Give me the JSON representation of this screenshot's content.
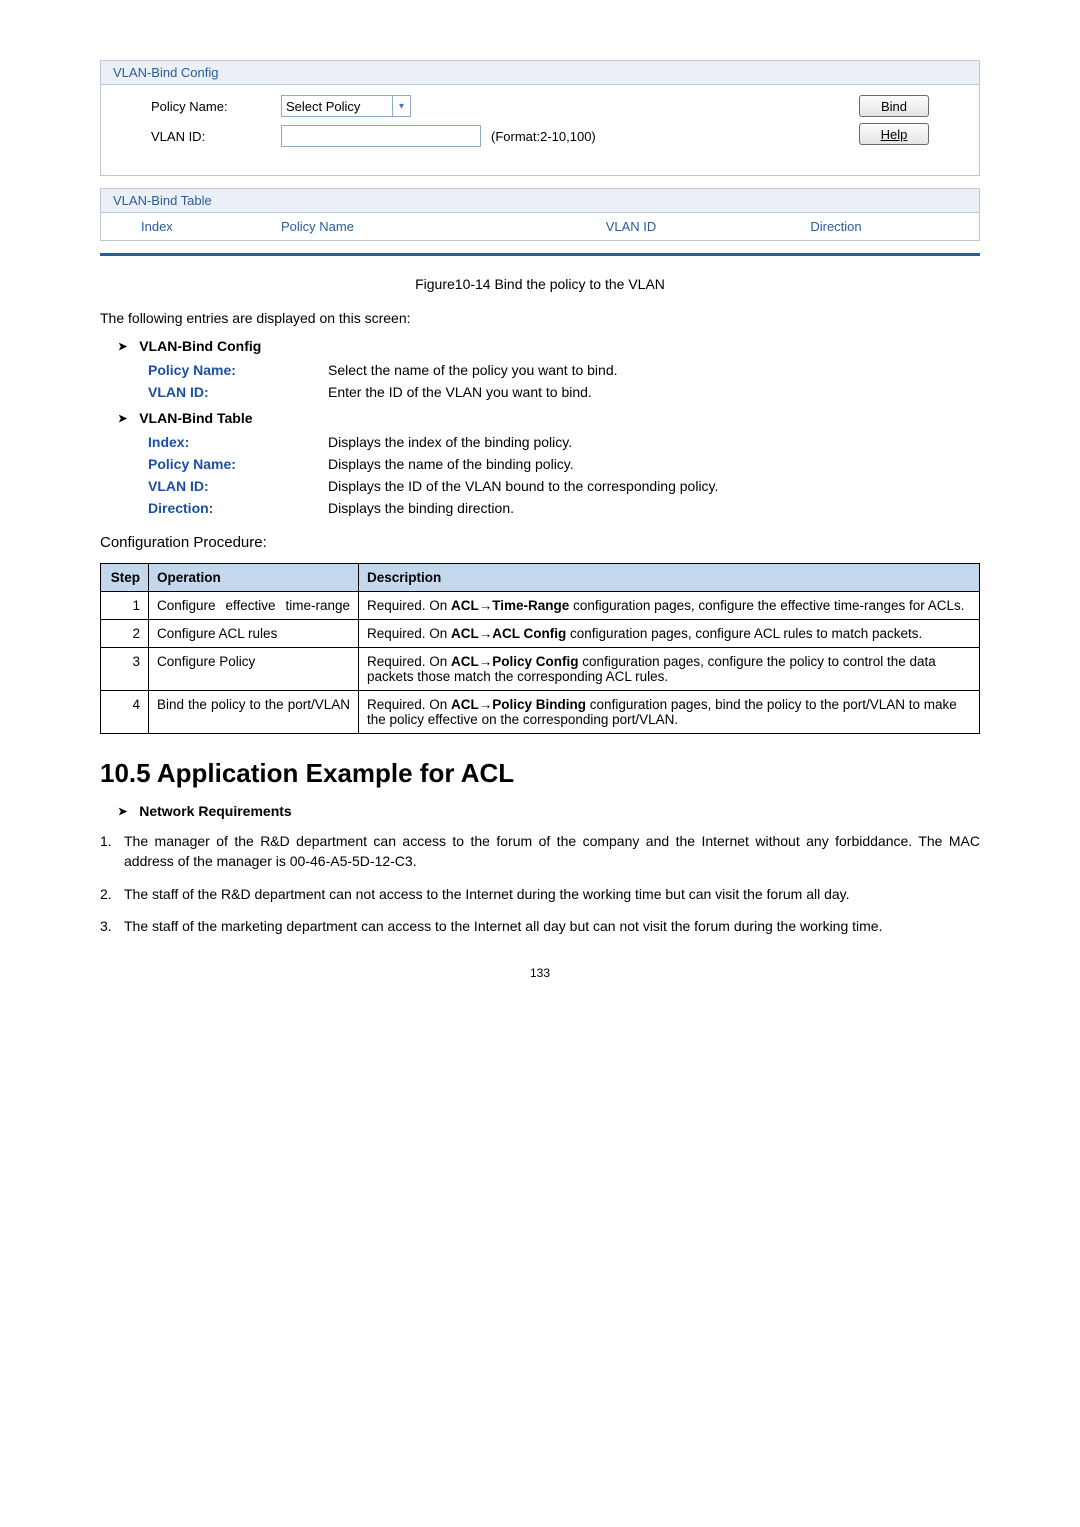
{
  "screenshot": {
    "panel1": {
      "title": "VLAN-Bind Config",
      "policyLabel": "Policy Name:",
      "policyValue": "Select Policy",
      "vlanLabel": "VLAN ID:",
      "vlanHint": "(Format:2-10,100)",
      "btnBind": "Bind",
      "btnHelp": "Help"
    },
    "panel2": {
      "title": "VLAN-Bind Table",
      "h1": "Index",
      "h2": "Policy Name",
      "h3": "VLAN ID",
      "h4": "Direction"
    }
  },
  "caption": "Figure10-14 Bind the policy to the VLAN",
  "intro": "The following entries are displayed on this screen:",
  "sectionA": {
    "title": "VLAN-Bind Config",
    "rows": [
      {
        "term": "Policy Name:",
        "desc": "Select the name of the policy you want to bind."
      },
      {
        "term": "VLAN ID:",
        "desc": "Enter the ID of the VLAN you want to bind."
      }
    ]
  },
  "sectionB": {
    "title": "VLAN-Bind Table",
    "rows": [
      {
        "term": "Index:",
        "desc": "Displays the index of the binding policy."
      },
      {
        "term": "Policy Name:",
        "desc": "Displays the name of the binding policy."
      },
      {
        "term": "VLAN ID:",
        "desc": "Displays the ID of the VLAN bound to the corresponding policy."
      },
      {
        "term": "Direction:",
        "desc": "Displays the binding direction."
      }
    ]
  },
  "procTitle": "Configuration Procedure:",
  "procHeaders": {
    "step": "Step",
    "op": "Operation",
    "desc": "Description"
  },
  "procRows": [
    {
      "n": "1",
      "op": "Configure effective time-range",
      "desc": "Required. On ACL→Time-Range configuration pages, configure the effective time-ranges for ACLs.",
      "bold": "ACL→Time-Range",
      "pre": "Required. On ",
      "post": " configuration pages, configure the effective time-ranges for ACLs."
    },
    {
      "n": "2",
      "op": "Configure ACL rules",
      "desc": "Required. On ACL→ACL Config configuration pages, configure ACL rules to match packets.",
      "bold": "ACL→ACL Config",
      "pre": "Required. On ",
      "post": " configuration pages, configure ACL rules to match packets."
    },
    {
      "n": "3",
      "op": "Configure Policy",
      "desc": "Required. On ACL→Policy Config configuration pages, configure the policy to control the data packets those match the corresponding ACL rules.",
      "bold": "ACL→Policy Config",
      "pre": "Required. On ",
      "post": " configuration pages, configure the policy to control the data packets those match the corresponding ACL rules."
    },
    {
      "n": "4",
      "op": "Bind the policy to the port/VLAN",
      "desc": "Required. On ACL→Policy Binding configuration pages, bind the policy to the port/VLAN to make the policy effective on the corresponding port/VLAN.",
      "bold": "ACL→Policy Binding",
      "pre": "Required. On ",
      "post": " configuration pages, bind the policy to the port/VLAN to make the policy effective on the corresponding port/VLAN."
    }
  ],
  "h2": "10.5 Application Example for ACL",
  "reqTitle": "Network Requirements",
  "reqs": [
    {
      "n": "1.",
      "t": "The manager of the R&D department can access to the forum of the company and the Internet without any forbiddance. The MAC address of the manager is 00-46-A5-5D-12-C3."
    },
    {
      "n": "2.",
      "t": "The staff of the R&D department can not access to the Internet during the working time but can visit the forum all day."
    },
    {
      "n": "3.",
      "t": "The staff of the marketing department can access to the Internet all day but can not visit the forum during the working time."
    }
  ],
  "pageNum": "133"
}
